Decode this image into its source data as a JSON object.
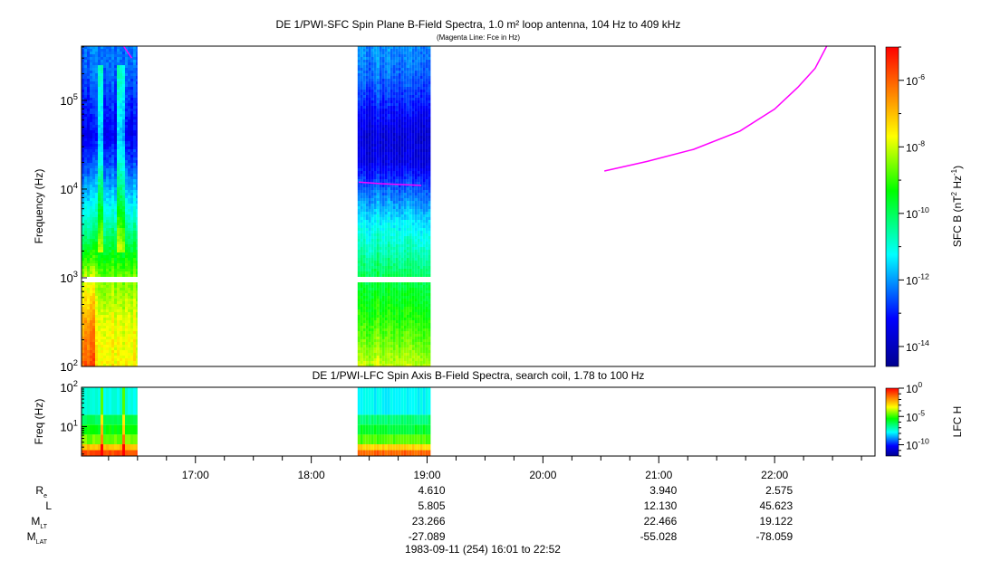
{
  "chart_data": [
    {
      "type": "heatmap",
      "title": "DE 1/PWI-SFC  Spin Plane B-Field Spectra, 1.0 m² loop antenna, 104 Hz to 409 kHz",
      "subtitle": "(Magenta Line: Fce in Hz)",
      "ylabel": "Frequency (Hz)",
      "yscale": "log",
      "ylim_hz": [
        100,
        409000
      ],
      "yticks": [
        {
          "exp": "2",
          "label": "10"
        },
        {
          "exp": "3",
          "label": "10"
        },
        {
          "exp": "4",
          "label": "10"
        },
        {
          "exp": "5",
          "label": "10"
        }
      ],
      "xlim_hours": [
        16.0167,
        22.8667
      ],
      "data_gap_hz": [
        900,
        1050
      ],
      "segments_hours": [
        [
          16.0167,
          16.5
        ],
        [
          18.4,
          19.03
        ]
      ],
      "approx_log10_intensity_profiles": {
        "log10_freq": [
          2.0,
          2.5,
          3.0,
          3.3,
          3.6,
          4.0,
          4.3,
          4.6,
          5.0,
          5.3,
          5.61
        ],
        "segment_1": [
          -7.6,
          -7.8,
          -8.6,
          -9.6,
          -10.6,
          -11.8,
          -12.6,
          -13.3,
          -12.8,
          -12.4,
          -12.2
        ],
        "segment_2": [
          -8.0,
          -9.0,
          -9.8,
          -10.6,
          -11.2,
          -12.4,
          -13.4,
          -13.6,
          -12.8,
          -12.3,
          -12.0
        ]
      },
      "fce_line": {
        "color": "#ff00ff",
        "points": [
          {
            "t": 16.38,
            "f": 409000
          },
          {
            "t": 16.45,
            "f": 300000
          },
          {
            "t": 18.41,
            "f": 12000
          },
          {
            "t": 18.6,
            "f": 11500
          },
          {
            "t": 18.95,
            "f": 11000
          },
          {
            "t": 20.53,
            "f": 16000
          },
          {
            "t": 20.9,
            "f": 20500
          },
          {
            "t": 21.3,
            "f": 28000
          },
          {
            "t": 21.7,
            "f": 45000
          },
          {
            "t": 22.0,
            "f": 80000
          },
          {
            "t": 22.2,
            "f": 140000
          },
          {
            "t": 22.35,
            "f": 230000
          },
          {
            "t": 22.45,
            "f": 409000
          }
        ]
      },
      "colorbar": {
        "label_main": "SFC B (nT",
        "label_sup1": "2",
        "label_mid": " Hz",
        "label_sup2": "-1",
        "label_end": ")",
        "range_log10": [
          -14.6,
          -5.0
        ],
        "ticks": [
          {
            "exp": "-6",
            "label": "10"
          },
          {
            "exp": "-8",
            "label": "10"
          },
          {
            "exp": "-10",
            "label": "10"
          },
          {
            "exp": "-12",
            "label": "10"
          },
          {
            "exp": "-14",
            "label": "10"
          }
        ]
      }
    },
    {
      "type": "heatmap",
      "title": "DE 1/PWI-LFC  Spin Axis B-Field Spectra, search coil, 1.78 to 100 Hz",
      "ylabel": "Freq (Hz)",
      "yscale": "log",
      "ylim_hz": [
        1.78,
        100
      ],
      "yticks": [
        {
          "exp": "2",
          "label": "10"
        },
        {
          "exp": "1",
          "label": "10"
        }
      ],
      "segments_hours": [
        [
          16.0167,
          16.5
        ],
        [
          18.4,
          19.03
        ]
      ],
      "band_edges_log10_hz": [
        0.25,
        0.4,
        0.55,
        0.8,
        1.05,
        1.3,
        2.0
      ],
      "band_log10_intensity": [
        -1.0,
        -2.5,
        -4.5,
        -5.5,
        -6.2,
        -7.5
      ],
      "colorbar": {
        "label": "LFC H",
        "range_log10": [
          -12,
          0
        ],
        "ticks": [
          {
            "exp": "0",
            "label": "10"
          },
          {
            "exp": "-5",
            "label": "10"
          },
          {
            "exp": "-10",
            "label": "10"
          }
        ]
      }
    }
  ],
  "x_axis": {
    "tick_labels": [
      "17:00",
      "18:00",
      "19:00",
      "20:00",
      "21:00",
      "22:00"
    ],
    "tick_hours": [
      17,
      18,
      19,
      20,
      21,
      22
    ]
  },
  "ephemeris": {
    "rows": [
      {
        "label": "R",
        "sub": "e",
        "values": [
          "",
          "",
          "4.610",
          "",
          "3.940",
          "2.575"
        ]
      },
      {
        "label": "L",
        "sub": "",
        "values": [
          "",
          "",
          "5.805",
          "",
          "12.130",
          "45.623"
        ]
      },
      {
        "label": "M",
        "sub": "LT",
        "values": [
          "",
          "",
          "23.266",
          "",
          "22.466",
          "19.122"
        ]
      },
      {
        "label": "M",
        "sub": "LAT",
        "values": [
          "",
          "",
          "-27.089",
          "",
          "-55.028",
          "-78.059"
        ]
      }
    ]
  },
  "footer": "1983-09-11 (254) 16:01 to 22:52"
}
